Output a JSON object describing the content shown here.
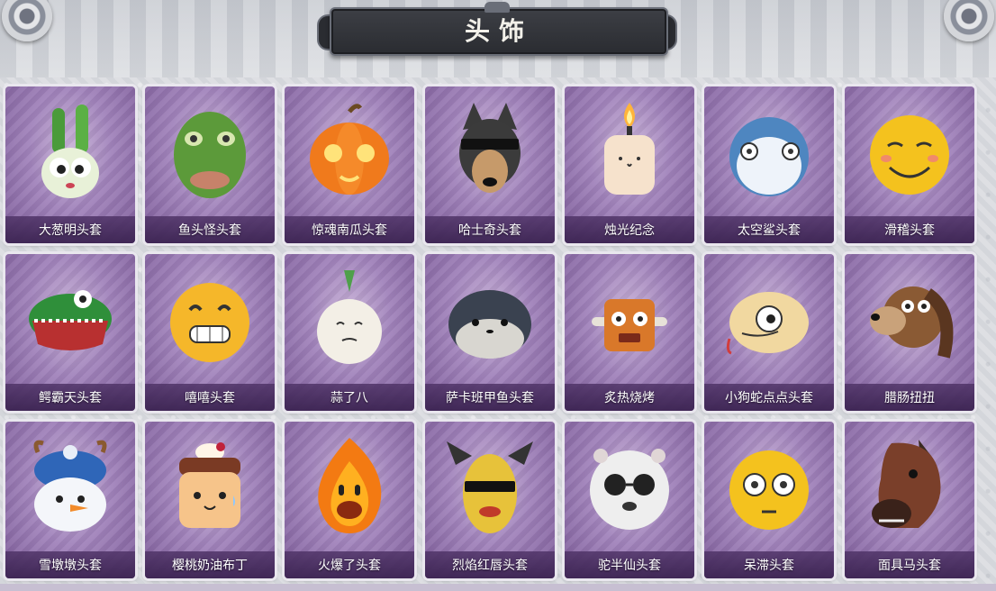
{
  "header": {
    "title": "头饰"
  },
  "items": [
    {
      "label": "大葱明头套",
      "icon": "scallion-head-icon"
    },
    {
      "label": "鱼头怪头套",
      "icon": "fish-head-icon"
    },
    {
      "label": "惊魂南瓜头套",
      "icon": "pumpkin-head-icon"
    },
    {
      "label": "哈士奇头套",
      "icon": "husky-head-icon"
    },
    {
      "label": "烛光纪念",
      "icon": "candle-head-icon"
    },
    {
      "label": "太空鲨头套",
      "icon": "shark-head-icon"
    },
    {
      "label": "滑稽头套",
      "icon": "funny-face-head-icon"
    },
    {
      "label": "鳄霸天头套",
      "icon": "crocodile-head-icon"
    },
    {
      "label": "嘻嘻头套",
      "icon": "grin-face-head-icon"
    },
    {
      "label": "蒜了八",
      "icon": "garlic-head-icon"
    },
    {
      "label": "萨卡班甲鱼头套",
      "icon": "sacabambaspis-head-icon"
    },
    {
      "label": "炙热烧烤",
      "icon": "bbq-head-icon"
    },
    {
      "label": "小狗蛇点点头套",
      "icon": "snake-head-icon"
    },
    {
      "label": "腊肠扭扭",
      "icon": "dachshund-head-icon"
    },
    {
      "label": "雪墩墩头套",
      "icon": "snowman-head-icon"
    },
    {
      "label": "樱桃奶油布丁",
      "icon": "pudding-head-icon"
    },
    {
      "label": "火爆了头套",
      "icon": "fire-head-icon"
    },
    {
      "label": "烈焰红唇头套",
      "icon": "pikachu-head-icon"
    },
    {
      "label": "驼半仙头套",
      "icon": "alpaca-head-icon"
    },
    {
      "label": "呆滞头套",
      "icon": "dazed-face-head-icon"
    },
    {
      "label": "面具马头套",
      "icon": "horse-mask-head-icon"
    }
  ],
  "colors": {
    "card_purple": "#a183bb",
    "banner_dark": "#2a2c31",
    "label_text": "#ffffff"
  }
}
